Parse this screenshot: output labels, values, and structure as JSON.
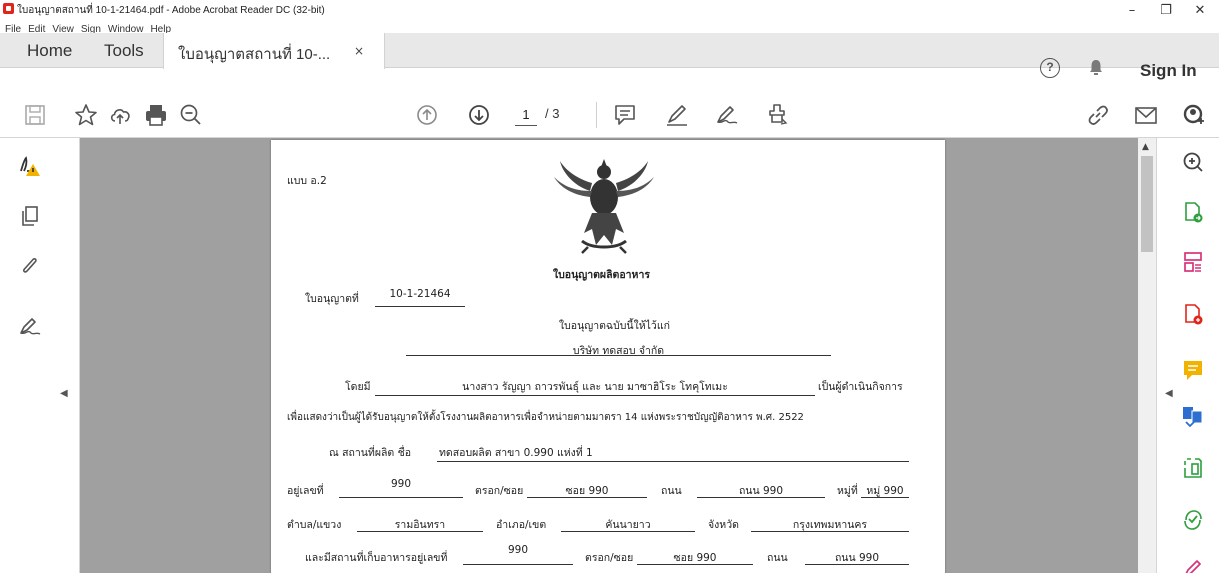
{
  "window": {
    "title": "ใบอนุญาตสถานที่ 10-1-21464.pdf - Adobe Acrobat Reader DC (32-bit)",
    "minimize": "–",
    "restore": "❐",
    "close": "✕"
  },
  "menu": [
    "File",
    "Edit",
    "View",
    "Sign",
    "Window",
    "Help"
  ],
  "tabs": {
    "home": "Home",
    "tools": "Tools",
    "document": "ใบอนุญาตสถานที่ 10-...",
    "close": "×",
    "help": "?",
    "signin": "Sign In"
  },
  "toolbar": {
    "page_current": "1",
    "page_total": "/ 3"
  },
  "colors": {
    "accent_red": "#e0251b",
    "green": "#2e9e3e",
    "blue": "#2d6fd1",
    "pink": "#d6337a",
    "yellow": "#f2b200",
    "canvas": "#a0a0a0"
  },
  "document": {
    "form_code": "แบบ อ.2",
    "heading": "ใบอนุญาตผลิตอาหาร",
    "license_no_label": "ใบอนุญาตที่",
    "license_no": "10-1-21464",
    "issued_to_label": "ใบอนุญาตฉบับนี้ให้ไว้แก่",
    "company": "บริษัท ทดสอบ จำกัด",
    "by_label": "โดยมี",
    "operators": "นางสาว รัญญา ถาวรพันธุ์ และ นาย มาซาฮิโระ โทคุโทเมะ",
    "operator_suffix": "เป็นผู้ดำเนินกิจการ",
    "statement": "เพื่อแสดงว่าเป็นผู้ได้รับอนุญาตให้ตั้งโรงงานผลิตอาหารเพื่อจำหน่ายตามมาตรา 14 แห่งพระราชบัญญัติอาหาร พ.ศ. 2522",
    "premises_label": "ณ สถานที่ผลิต ชื่อ",
    "premises_name": "ทดสอบผลิต สาขา 0.990 แห่งที่ 1",
    "address": {
      "no_label": "อยู่เลขที่",
      "no": "990",
      "soi_label": "ตรอก/ซอย",
      "soi": "ซอย 990",
      "road_label": "ถนน",
      "road": "ถนน 990",
      "moo_label": "หมู่ที่",
      "moo": "หมู่ 990",
      "tambon_label": "ตำบล/แขวง",
      "tambon": "รามอินทรา",
      "amphoe_label": "อำเภอ/เขต",
      "amphoe": "คันนายาว",
      "province_label": "จังหวัด",
      "province": "กรุงเทพมหานคร"
    },
    "storage": {
      "label": "และมีสถานที่เก็บอาหารอยู่เลขที่",
      "no": "990",
      "soi_label": "ตรอก/ซอย",
      "soi": "ซอย 990",
      "road_label": "ถนน",
      "road": "ถนน 990"
    }
  }
}
